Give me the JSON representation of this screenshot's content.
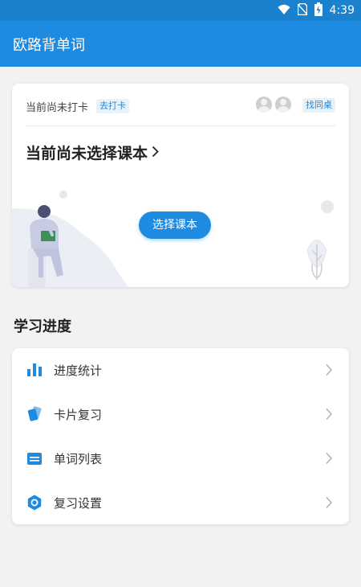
{
  "status_bar": {
    "time": "4:39",
    "icons": [
      "wifi-icon",
      "no-sim-icon",
      "battery-charging-icon"
    ]
  },
  "app_bar": {
    "title": "欧路背单词"
  },
  "book_card": {
    "checkin_status": "当前尚未打卡",
    "checkin_button": "去打卡",
    "find_deskmate_button": "找同桌",
    "no_book_title": "当前尚未选择课本",
    "select_book_button": "选择课本"
  },
  "progress_section": {
    "title": "学习进度",
    "items": [
      {
        "label": "进度统计",
        "icon": "bar-chart-icon"
      },
      {
        "label": "卡片复习",
        "icon": "flash-cards-icon"
      },
      {
        "label": "单词列表",
        "icon": "word-list-icon"
      },
      {
        "label": "复习设置",
        "icon": "settings-hexagon-icon"
      }
    ]
  },
  "colors": {
    "accent": "#1e8be0",
    "status_bar": "#1a81cf",
    "background": "#f2f2f2"
  }
}
